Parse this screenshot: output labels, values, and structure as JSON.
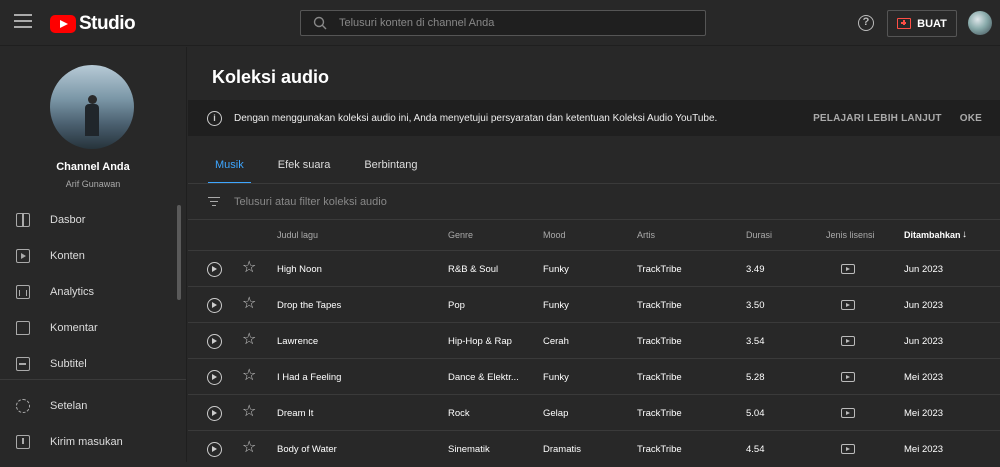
{
  "app": {
    "logo_text": "Studio"
  },
  "search": {
    "placeholder": "Telusuri konten di channel Anda"
  },
  "header": {
    "create_label": "BUAT"
  },
  "sidebar": {
    "channel_name": "Channel Anda",
    "channel_owner": "Arif Gunawan",
    "items": [
      {
        "label": "Dasbor",
        "icon": "dashboard-icon"
      },
      {
        "label": "Konten",
        "icon": "content-icon"
      },
      {
        "label": "Analytics",
        "icon": "analytics-icon"
      },
      {
        "label": "Komentar",
        "icon": "comments-icon"
      },
      {
        "label": "Subtitel",
        "icon": "subtitles-icon"
      },
      {
        "label": "Setelan",
        "icon": "settings-icon"
      },
      {
        "label": "Kirim masukan",
        "icon": "feedback-icon"
      }
    ]
  },
  "page": {
    "title": "Koleksi audio",
    "banner_text": "Dengan menggunakan koleksi audio ini, Anda menyetujui persyaratan dan ketentuan Koleksi Audio YouTube.",
    "banner_learn_more": "PELAJARI LEBIH LANJUT",
    "banner_ok": "OKE",
    "tabs": [
      "Musik",
      "Efek suara",
      "Berbintang"
    ],
    "filter_placeholder": "Telusuri atau filter koleksi audio"
  },
  "table": {
    "columns": [
      "Judul lagu",
      "Genre",
      "Mood",
      "Artis",
      "Durasi",
      "Jenis lisensi",
      "Ditambahkan"
    ],
    "sorted_column": "Ditambahkan",
    "sort_arrow": "↓",
    "rows": [
      {
        "title": "High Noon",
        "genre": "R&B & Soul",
        "mood": "Funky",
        "artist": "TrackTribe",
        "duration": "3.49",
        "added": "Jun 2023"
      },
      {
        "title": "Drop the Tapes",
        "genre": "Pop",
        "mood": "Funky",
        "artist": "TrackTribe",
        "duration": "3.50",
        "added": "Jun 2023"
      },
      {
        "title": "Lawrence",
        "genre": "Hip-Hop & Rap",
        "mood": "Cerah",
        "artist": "TrackTribe",
        "duration": "3.54",
        "added": "Jun 2023"
      },
      {
        "title": "I Had a Feeling",
        "genre": "Dance & Elektr...",
        "mood": "Funky",
        "artist": "TrackTribe",
        "duration": "5.28",
        "added": "Mei 2023"
      },
      {
        "title": "Dream It",
        "genre": "Rock",
        "mood": "Gelap",
        "artist": "TrackTribe",
        "duration": "5.04",
        "added": "Mei 2023"
      },
      {
        "title": "Body of Water",
        "genre": "Sinematik",
        "mood": "Dramatis",
        "artist": "TrackTribe",
        "duration": "4.54",
        "added": "Mei 2023"
      }
    ]
  }
}
